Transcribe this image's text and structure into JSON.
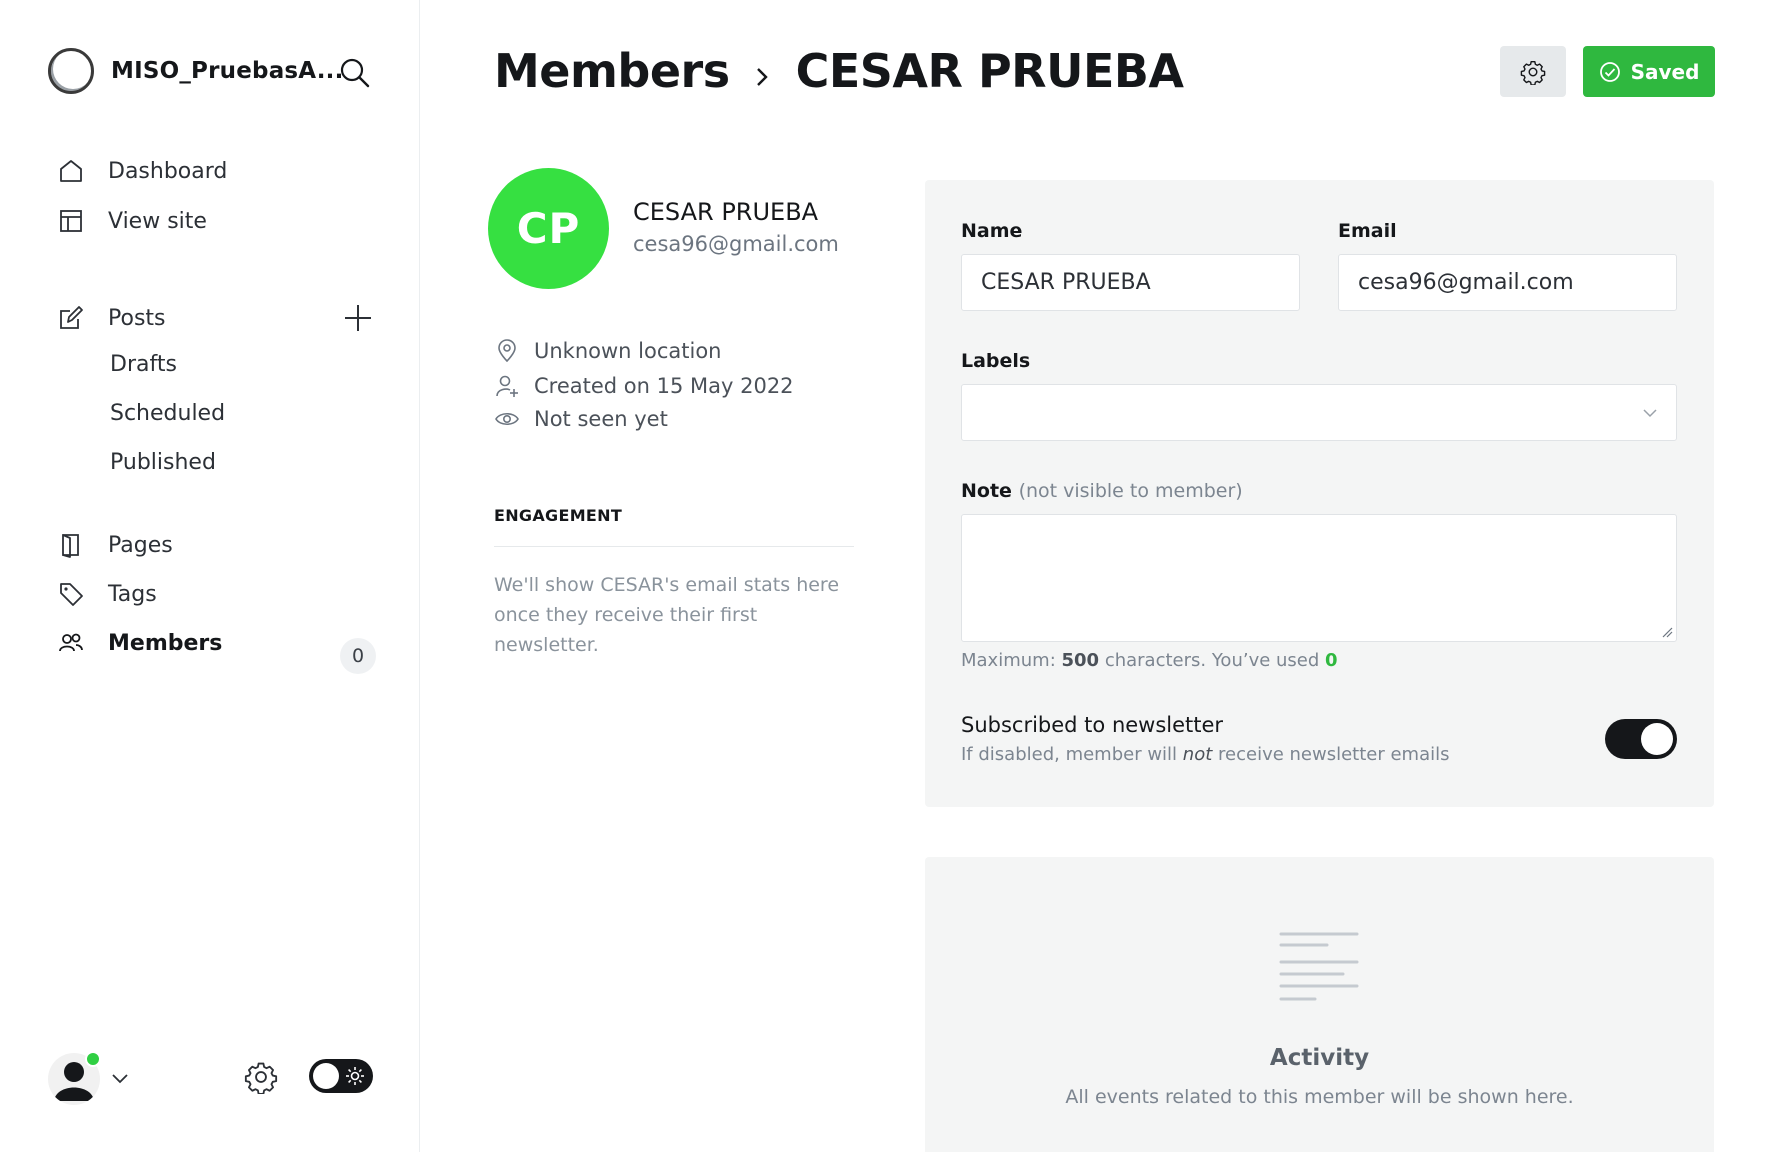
{
  "sidebar": {
    "brand_name": "MISO_PruebasA...",
    "nav": {
      "dashboard": "Dashboard",
      "view_site": "View site",
      "posts": "Posts",
      "drafts": "Drafts",
      "scheduled": "Scheduled",
      "published": "Published",
      "pages": "Pages",
      "tags": "Tags",
      "members": "Members",
      "members_count": "0"
    },
    "icons": [
      "search-icon",
      "home-icon",
      "layout-icon",
      "edit-icon",
      "plus-icon",
      "page-icon",
      "tag-icon",
      "members-icon",
      "chevron-down-icon",
      "gear-icon",
      "sun-icon"
    ]
  },
  "header": {
    "breadcrumb_parent": "Members",
    "breadcrumb_current": "CESAR PRUEBA",
    "saved_label": "Saved"
  },
  "member": {
    "initials": "CP",
    "name": "CESAR PRUEBA",
    "email": "cesa96@gmail.com",
    "location": "Unknown location",
    "created": "Created on 15 May 2022",
    "seen": "Not seen yet",
    "avatar_color": "#36e041"
  },
  "engagement": {
    "title": "ENGAGEMENT",
    "text": "We'll show CESAR's email stats here once they receive their first newsletter."
  },
  "form": {
    "name_label": "Name",
    "name_value": "CESAR PRUEBA",
    "email_label": "Email",
    "email_value": "cesa96@gmail.com",
    "labels_label": "Labels",
    "labels_value": "",
    "note_label": "Note",
    "note_hint": "(not visible to member)",
    "note_value": "",
    "counter_prefix": "Maximum:",
    "counter_max": "500",
    "counter_mid": "characters. You’ve used",
    "counter_used": "0",
    "newsletter_title": "Subscribed to newsletter",
    "newsletter_desc_before": "If disabled, member will",
    "newsletter_desc_em": "not",
    "newsletter_desc_after": "receive newsletter emails",
    "newsletter_subscribed": true
  },
  "activity": {
    "title": "Activity",
    "desc": "All events related to this member will be shown here."
  },
  "colors": {
    "accent_green": "#2fb83f",
    "dark": "#15171a",
    "card_bg": "#f4f5f5"
  }
}
